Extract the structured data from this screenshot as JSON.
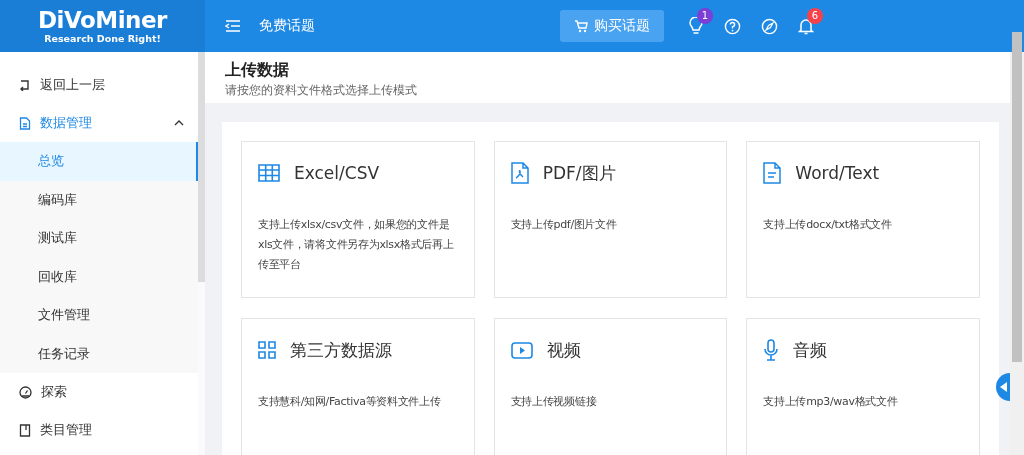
{
  "logo": {
    "name": "DiVoMiner",
    "tagline": "Research Done Right!"
  },
  "header": {
    "title": "免费话题",
    "buy_button": "购买话题",
    "badges": {
      "ideas": "1",
      "notifications": "6"
    }
  },
  "sidebar": {
    "items": [
      {
        "kind": "back",
        "label": "返回上一层",
        "selected": false
      },
      {
        "kind": "group",
        "label": "数据管理",
        "expanded": true,
        "selected": false,
        "children": [
          {
            "label": "总览",
            "selected": true
          },
          {
            "label": "编码库",
            "selected": false
          },
          {
            "label": "测试库",
            "selected": false
          },
          {
            "label": "回收库",
            "selected": false
          },
          {
            "label": "文件管理",
            "selected": false
          },
          {
            "label": "任务记录",
            "selected": false
          }
        ]
      },
      {
        "kind": "item",
        "label": "探索",
        "selected": false
      },
      {
        "kind": "item",
        "label": "类目管理",
        "selected": false
      }
    ]
  },
  "page": {
    "title": "上传数据",
    "subtitle": "请按您的资料文件格式选择上传模式"
  },
  "cards": [
    {
      "title": "Excel/CSV",
      "description": "支持上传xlsx/csv文件，如果您的文件是xls文件，请将文件另存为xlsx格式后再上传至平台"
    },
    {
      "title": "PDF/图片",
      "description": "支持上传pdf/图片文件"
    },
    {
      "title": "Word/Text",
      "description": "支持上传docx/txt格式文件"
    },
    {
      "title": "第三方数据源",
      "description": "支持慧科/知网/Factiva等资料文件上传"
    },
    {
      "title": "视频",
      "description": "支持上传视频链接"
    },
    {
      "title": "音频",
      "description": "支持上传mp3/wav格式文件"
    }
  ]
}
